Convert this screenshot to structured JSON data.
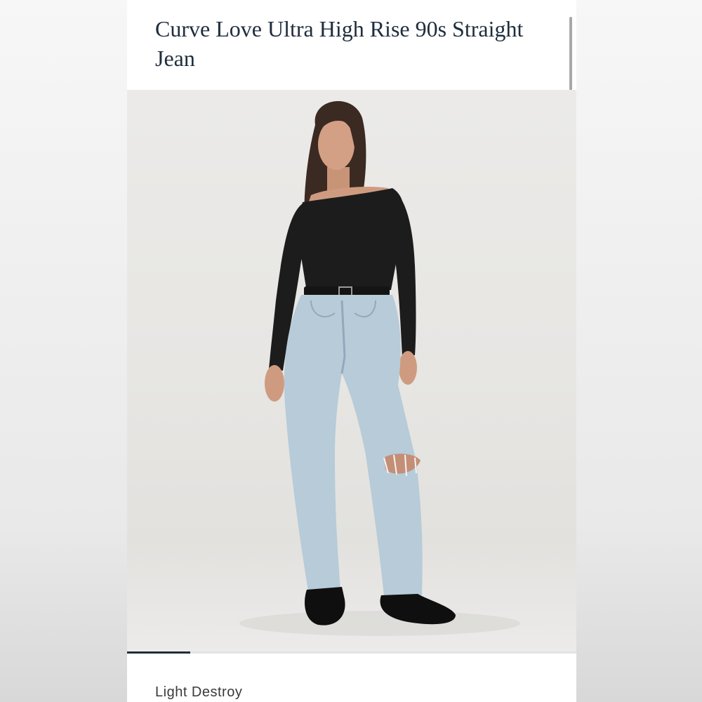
{
  "product": {
    "title": "Curve Love Ultra High Rise 90s Straight Jean",
    "image_alt": "Model wearing light wash ripped straight leg jeans with a black off-shoulder top, belt and loafers",
    "color_name": "Light Destroy"
  },
  "carousel": {
    "progress": 0.14
  },
  "colors": {
    "title_text": "#1f2d3d",
    "indicator": "#1f2d3d"
  }
}
